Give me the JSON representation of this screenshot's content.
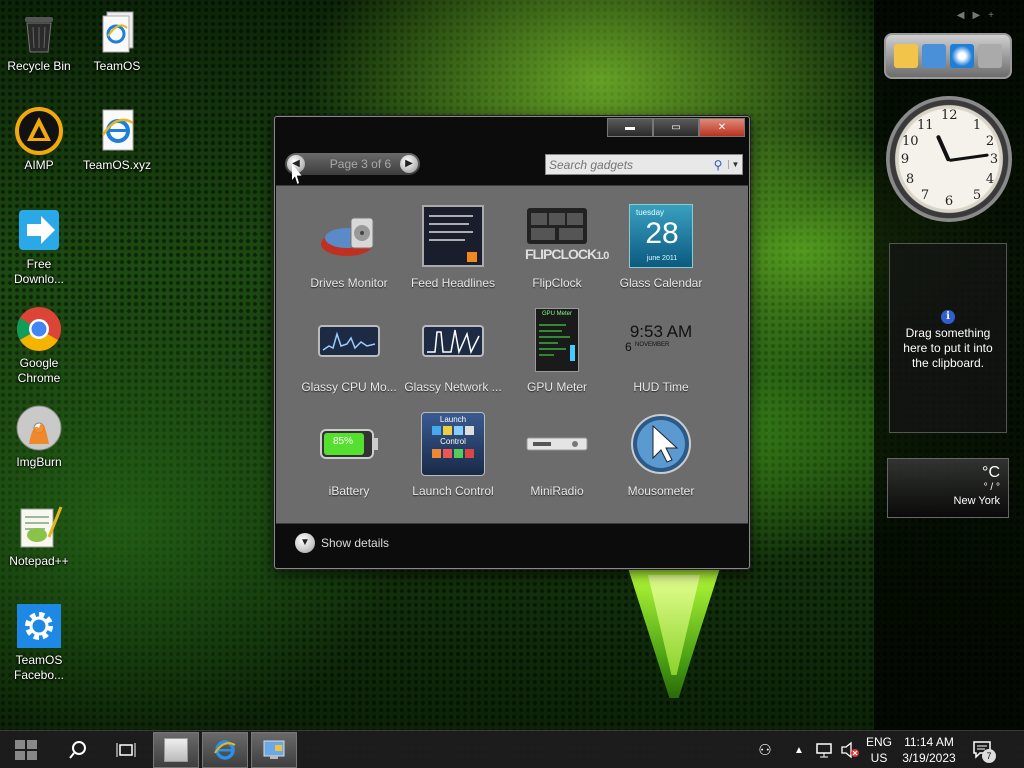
{
  "desktop": {
    "icons": [
      {
        "label": "Recycle Bin"
      },
      {
        "label": "TeamOS"
      },
      {
        "label": "AIMP"
      },
      {
        "label": "TeamOS.xyz"
      },
      {
        "label": "Free Downlo..."
      },
      {
        "label": "Google Chrome"
      },
      {
        "label": "ImgBurn"
      },
      {
        "label": "Notepad++"
      },
      {
        "label": "TeamOS Facebo..."
      }
    ]
  },
  "gadget_window": {
    "pager_label": "Page 3 of 6",
    "search_placeholder": "Search gadgets",
    "gadgets": [
      {
        "label": "Drives Monitor"
      },
      {
        "label": "Feed Headlines"
      },
      {
        "label": "FlipClock"
      },
      {
        "label": "Glass Calendar"
      },
      {
        "label": "Glassy CPU Mo..."
      },
      {
        "label": "Glassy Network ..."
      },
      {
        "label": "GPU Meter"
      },
      {
        "label": "HUD Time"
      },
      {
        "label": "iBattery"
      },
      {
        "label": "Launch Control"
      },
      {
        "label": "MiniRadio"
      },
      {
        "label": "Mousometer"
      }
    ],
    "thumb_text": {
      "flipclock_brand": "FLIPCLOCK",
      "flipclock_version": "1.0",
      "calendar_weekday": "tuesday",
      "calendar_day": "28",
      "calendar_month": "june 2011",
      "hud_time": "9:53 AM",
      "hud_day": "6",
      "hud_month": "NOVEMBER",
      "battery_pct": "85%",
      "launch_title": "Launch",
      "launch_sub": "Control",
      "gpu_title": "GPU Meter"
    },
    "show_details_label": "Show details"
  },
  "sidebar": {
    "clipboard_text": "Drag something here to put it into the clipboard.",
    "weather_temp": "°C",
    "weather_sep": "° / °",
    "weather_city": "New York"
  },
  "taskbar": {
    "lang": "ENG",
    "region": "US",
    "time": "11:14 AM",
    "date": "3/19/2023",
    "notif_count": "7"
  },
  "colors": {
    "accent_green": "#8cd22a",
    "close_red": "#b8321e",
    "gallery_bg": "#6c6c6c"
  }
}
